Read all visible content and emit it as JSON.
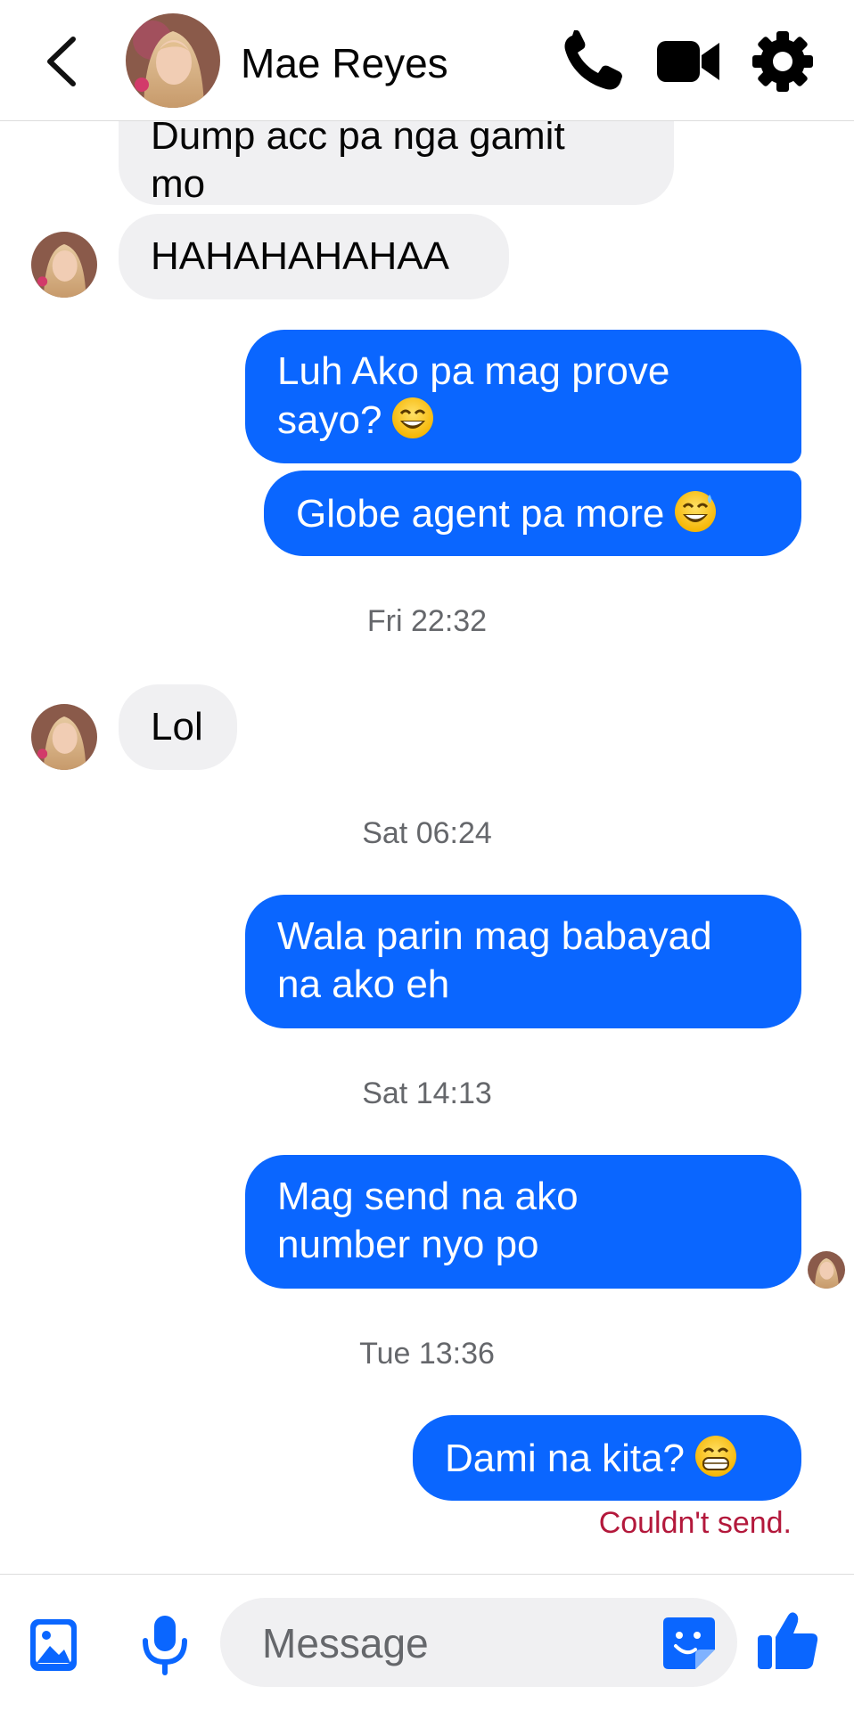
{
  "header": {
    "contact_name": "Mae Reyes",
    "icons": [
      "back-arrow-icon",
      "contact-avatar",
      "phone-icon",
      "video-camera-icon",
      "gear-icon"
    ]
  },
  "messages": [
    {
      "side": "in",
      "text_line1": "Dump acc pa nga gamit",
      "text_line2": "mo"
    },
    {
      "side": "in",
      "text": "HAHAHAHAHAA"
    },
    {
      "side": "out",
      "text_line1": "Luh Ako pa mag prove",
      "text_line2": "sayo?",
      "emoji": "smiling-face-emoji"
    },
    {
      "side": "out",
      "text": "Globe agent pa more",
      "emoji": "sweat-smile-emoji"
    },
    {
      "timestamp": "Fri 22:32"
    },
    {
      "side": "in",
      "text": "Lol"
    },
    {
      "timestamp": "Sat 06:24"
    },
    {
      "side": "out",
      "text_line1": "Wala parin mag babayad",
      "text_line2": "na ako eh"
    },
    {
      "timestamp": "Sat 14:13"
    },
    {
      "side": "out",
      "text_line1": "Mag send na ako",
      "text_line2": "number nyo po"
    },
    {
      "timestamp": "Tue 13:36"
    },
    {
      "side": "out",
      "text": "Dami na kita?",
      "emoji": "grinning-face-emoji",
      "status": "Couldn't send."
    }
  ],
  "composer": {
    "placeholder": "Message",
    "icons": [
      "image-icon",
      "microphone-icon",
      "sticker-icon",
      "thumbs-up-icon"
    ]
  },
  "colors": {
    "accent": "#0a66ff",
    "incoming_bubble": "#f0f0f2",
    "error": "#b3183b",
    "timestamp": "#65676b"
  }
}
